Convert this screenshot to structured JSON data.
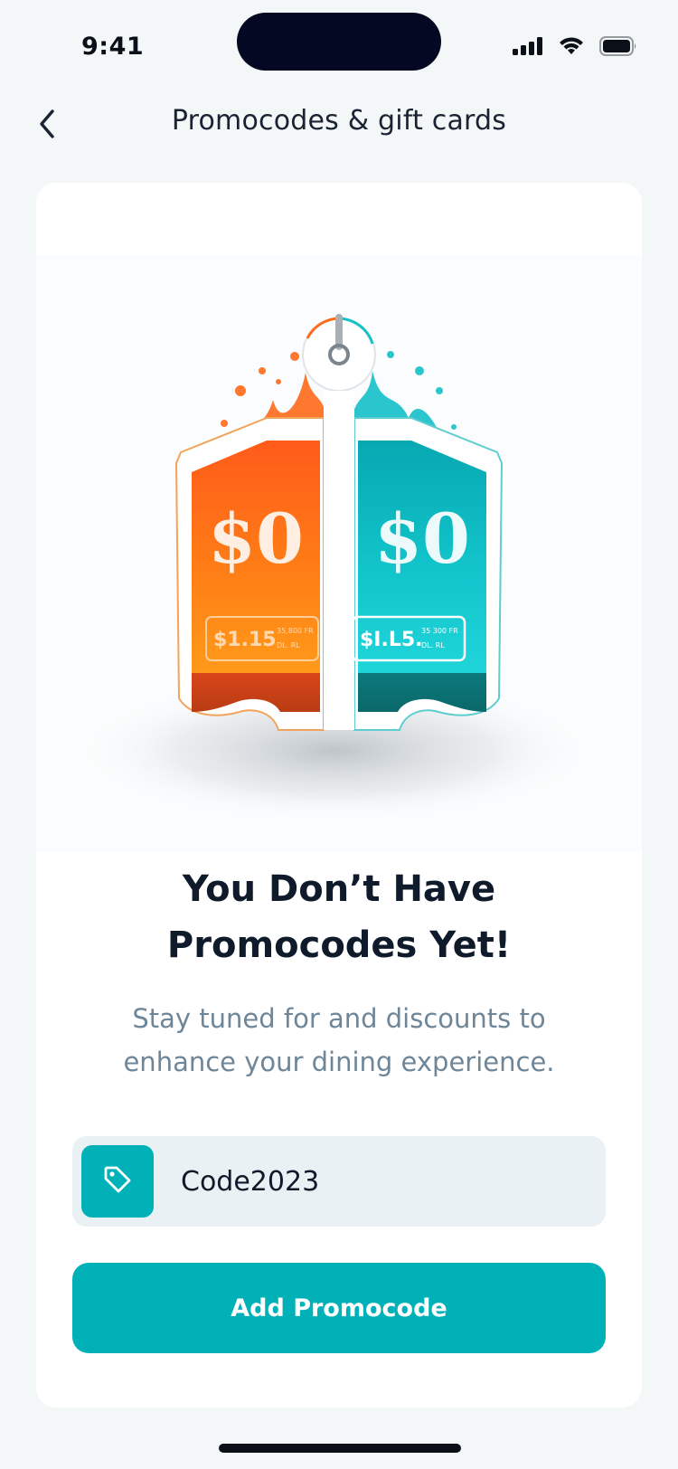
{
  "status_bar": {
    "time": "9:41"
  },
  "header": {
    "title": "Promocodes & gift cards",
    "back_icon": "chevron-left-icon"
  },
  "illustration": {
    "left_tag": {
      "big_text": "$0",
      "price_text": "$1.15",
      "fine_text_1": "35,800 FR",
      "fine_text_2": "DL. RL"
    },
    "right_tag": {
      "big_text": "$0",
      "price_text": "$I.L5.",
      "fine_text_1": "35 300 FR",
      "fine_text_2": "DL. RL"
    }
  },
  "empty_state": {
    "headline_line1": "You Don’t Have",
    "headline_line2": "Promocodes Yet!",
    "subtext_line1": "Stay tuned for and discounts to",
    "subtext_line2": "enhance your dining experience."
  },
  "promo_input": {
    "value": "Code2023",
    "icon": "tag-icon"
  },
  "add_button": {
    "label": "Add Promocode"
  },
  "colors": {
    "accent": "#00b2b8",
    "background": "#f3f7f8",
    "card": "#ffffff",
    "input_bg": "#eaf1f4",
    "title_text": "#0f1a2a",
    "muted_text": "#6e8698",
    "tag_orange": "#fb7a10",
    "tag_teal": "#14c6cc"
  }
}
